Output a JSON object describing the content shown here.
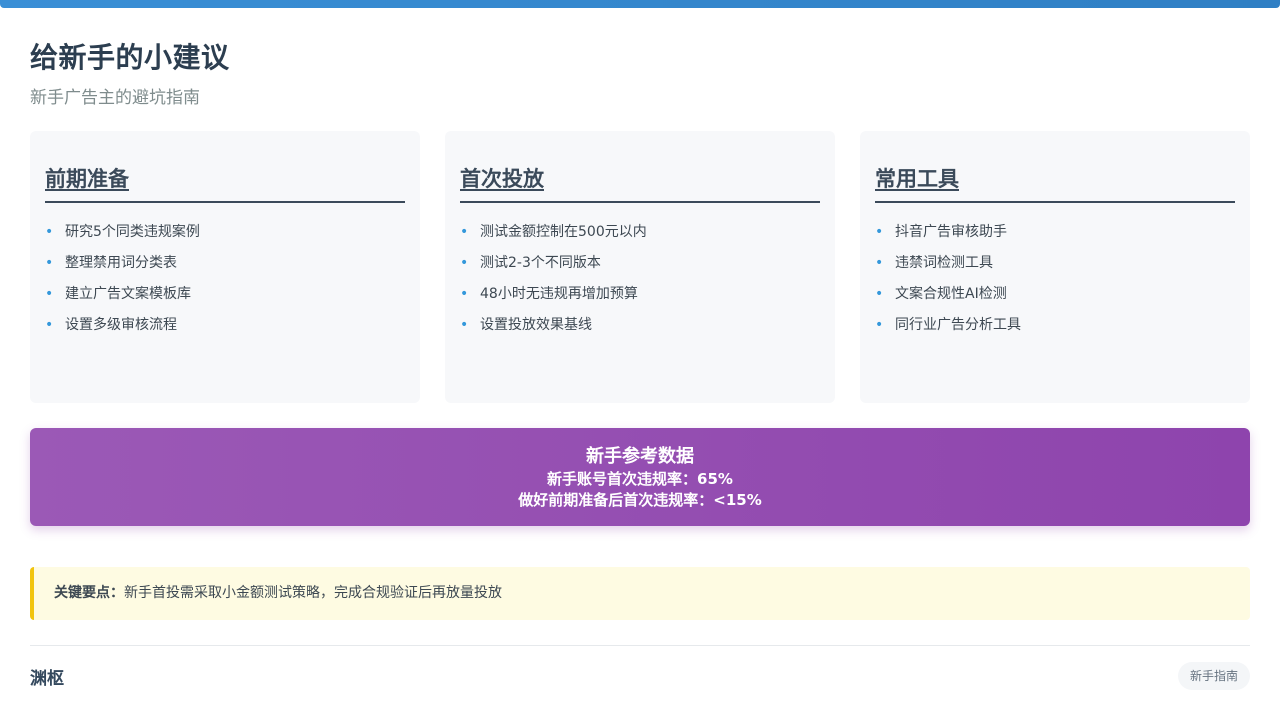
{
  "page": {
    "title": "给新手的小建议",
    "subtitle": "新手广告主的避坑指南"
  },
  "cards": [
    {
      "title": "前期准备",
      "items": [
        "研究5个同类违规案例",
        "整理禁用词分类表",
        "建立广告文案模板库",
        "设置多级审核流程"
      ]
    },
    {
      "title": "首次投放",
      "items": [
        "测试金额控制在500元以内",
        "测试2-3个不同版本",
        "48小时无违规再增加预算",
        "设置投放效果基线"
      ]
    },
    {
      "title": "常用工具",
      "items": [
        "抖音广告审核助手",
        "违禁词检测工具",
        "文案合规性AI检测",
        "同行业广告分析工具"
      ]
    }
  ],
  "banner": {
    "title": "新手参考数据",
    "line1": "新手账号首次违规率：65%",
    "line2": "做好前期准备后首次违规率：<15%"
  },
  "tip": {
    "label": "关键要点：",
    "text": "新手首投需采取小金额测试策略，完成合规验证后再放量投放"
  },
  "footer": {
    "brand": "渊枢",
    "badge": "新手指南"
  },
  "colors": {
    "accent": "#3498db",
    "banner_start": "#9b59b6",
    "banner_end": "#8e44ad",
    "tip_border": "#f1c40f"
  }
}
